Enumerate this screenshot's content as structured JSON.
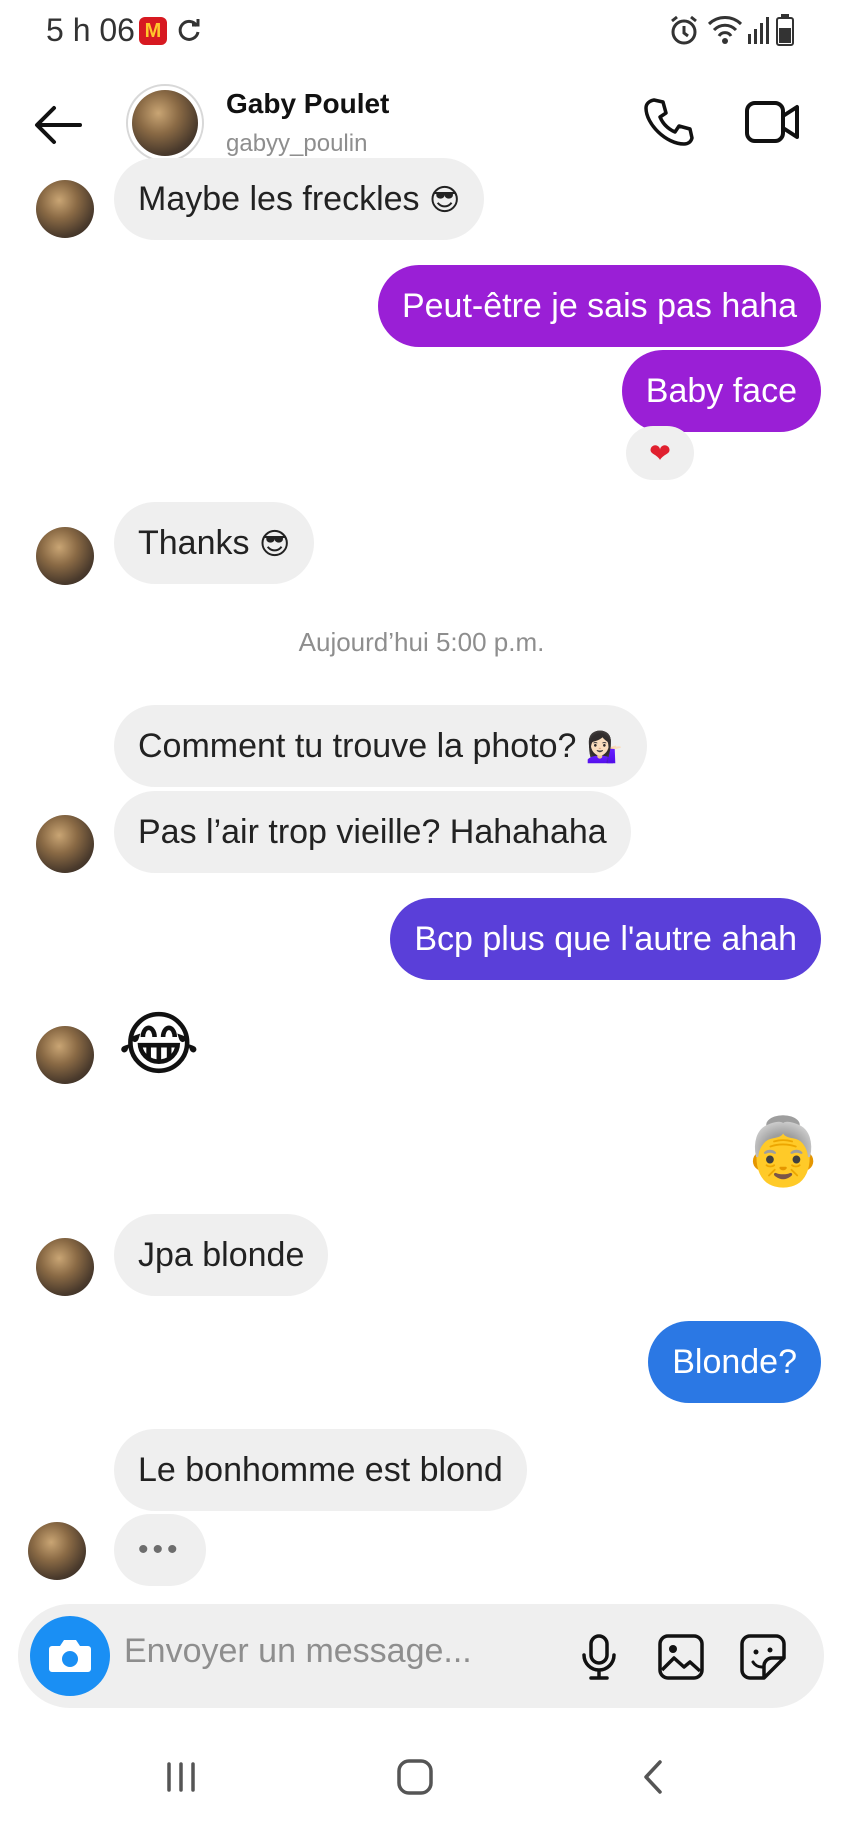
{
  "status_bar": {
    "time": "5 h 06",
    "mcd_letter": "M"
  },
  "header": {
    "name": "Gaby Poulet",
    "handle": "gabyy_poulin"
  },
  "messages": [
    {
      "text": "Maybe les freckles",
      "emoji": "😎"
    },
    {
      "text": "Peut-être je sais pas haha"
    },
    {
      "text": "Baby face",
      "reaction": "❤"
    },
    {
      "text": "Thanks",
      "emoji": "😎"
    },
    {
      "text": "Comment tu trouve la photo?",
      "emoji": "💁🏻‍♀️"
    },
    {
      "text": "Pas l’air trop vieille? Hahahaha"
    },
    {
      "text": "Bcp plus que l'autre ahah"
    },
    {
      "emoji": "😂"
    },
    {
      "emoji": "👵"
    },
    {
      "text": "Jpa blonde"
    },
    {
      "text": "Blonde?"
    },
    {
      "text": "Le bonhomme est blond"
    },
    {
      "text": "•••"
    }
  ],
  "timestamp": "Aujourd’hui 5:00 p.m.",
  "composer": {
    "placeholder": "Envoyer un message..."
  },
  "colors": {
    "bubble_purple": "#9a1fd6",
    "bubble_violet": "#5a3fd9",
    "bubble_blue": "#2b78e4",
    "bubble_gray": "#efefef",
    "camera_blue": "#1a8ff4"
  },
  "icons": [
    "back-arrow-icon",
    "phone-icon",
    "video-icon",
    "camera-icon",
    "microphone-icon",
    "gallery-icon",
    "sticker-icon",
    "recents-icon",
    "home-icon",
    "nav-back-icon"
  ]
}
